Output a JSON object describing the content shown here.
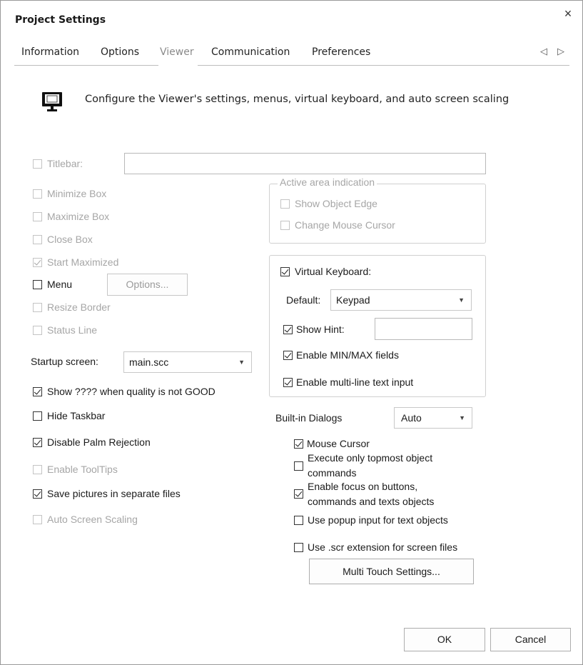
{
  "window": {
    "title": "Project Settings",
    "close_glyph": "×"
  },
  "tabs": [
    {
      "label": "Information",
      "active": false
    },
    {
      "label": "Options",
      "active": false
    },
    {
      "label": "Viewer",
      "active": true
    },
    {
      "label": "Communication",
      "active": false
    },
    {
      "label": "Preferences",
      "active": false
    }
  ],
  "tab_scroll": {
    "left": "◁",
    "right": "▷"
  },
  "header": {
    "icon": "monitor-icon",
    "text": "Configure the Viewer's settings, menus, virtual keyboard, and auto screen scaling"
  },
  "left": {
    "titlebar": {
      "label": "Titlebar:",
      "checked": false,
      "enabled": false,
      "value": ""
    },
    "minimize_box": {
      "label": "Minimize Box",
      "checked": false,
      "enabled": false
    },
    "maximize_box": {
      "label": "Maximize Box",
      "checked": false,
      "enabled": false
    },
    "close_box": {
      "label": "Close Box",
      "checked": false,
      "enabled": false
    },
    "start_maximized": {
      "label": "Start Maximized",
      "checked": true,
      "enabled": false
    },
    "menu": {
      "label": "Menu",
      "checked": false,
      "enabled": true,
      "options_button": "Options..."
    },
    "resize_border": {
      "label": "Resize Border",
      "checked": false,
      "enabled": false
    },
    "status_line": {
      "label": "Status Line",
      "checked": false,
      "enabled": false
    },
    "startup_screen": {
      "label": "Startup screen:",
      "value": "main.scc"
    },
    "show_quality": {
      "label": "Show ???? when quality is not GOOD",
      "checked": true
    },
    "hide_taskbar": {
      "label": "Hide Taskbar",
      "checked": false
    },
    "disable_palm": {
      "label": "Disable Palm Rejection",
      "checked": true
    },
    "enable_tooltips": {
      "label": "Enable ToolTips",
      "checked": false,
      "enabled": false
    },
    "save_pictures": {
      "label": "Save pictures in separate files",
      "checked": true
    },
    "auto_scaling": {
      "label": "Auto Screen Scaling",
      "checked": false,
      "enabled": false
    }
  },
  "active_area": {
    "legend": "Active area indication",
    "show_edge": {
      "label": "Show Object Edge",
      "checked": false
    },
    "change_cursor": {
      "label": "Change Mouse Cursor",
      "checked": false
    }
  },
  "virtual_keyboard": {
    "label": "Virtual Keyboard:",
    "checked": true,
    "default_label": "Default:",
    "default_value": "Keypad",
    "show_hint": {
      "label": "Show Hint:",
      "checked": true,
      "value": ""
    },
    "minmax": {
      "label": "Enable MIN/MAX fields",
      "checked": true
    },
    "multiline": {
      "label": "Enable multi-line text input",
      "checked": true
    }
  },
  "builtin": {
    "label": "Built-in Dialogs",
    "value": "Auto"
  },
  "right_options": {
    "mouse_cursor": {
      "label": "Mouse Cursor",
      "checked": true
    },
    "topmost_1": "Execute only topmost object",
    "topmost_2": "commands",
    "topmost_checked": false,
    "focus_1": "Enable focus on buttons,",
    "focus_2": "commands and texts objects",
    "focus_checked": true,
    "popup": {
      "label": "Use popup input for text objects",
      "checked": false
    },
    "scr_ext": {
      "label": "Use .scr extension for screen files",
      "checked": false
    },
    "multitouch_button": "Multi Touch Settings..."
  },
  "footer": {
    "ok": "OK",
    "cancel": "Cancel"
  }
}
